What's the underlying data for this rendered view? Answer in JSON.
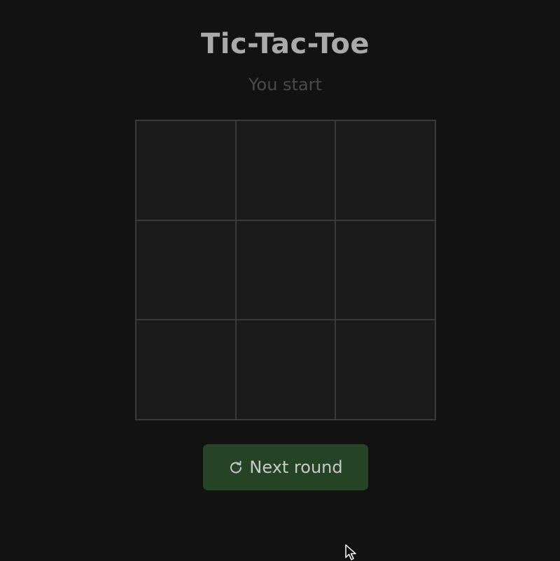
{
  "header": {
    "title": "Tic-Tac-Toe",
    "status": "You start"
  },
  "board": {
    "cells": [
      "",
      "",
      "",
      "",
      "",
      "",
      "",
      "",
      ""
    ]
  },
  "controls": {
    "next_round_label": "Next round",
    "next_round_icon": "refresh-icon"
  },
  "colors": {
    "background": "#121212",
    "cell": "#1b1b1b",
    "grid_line": "#3a3a3a",
    "button": "#254425",
    "title": "#aaaaaa"
  }
}
